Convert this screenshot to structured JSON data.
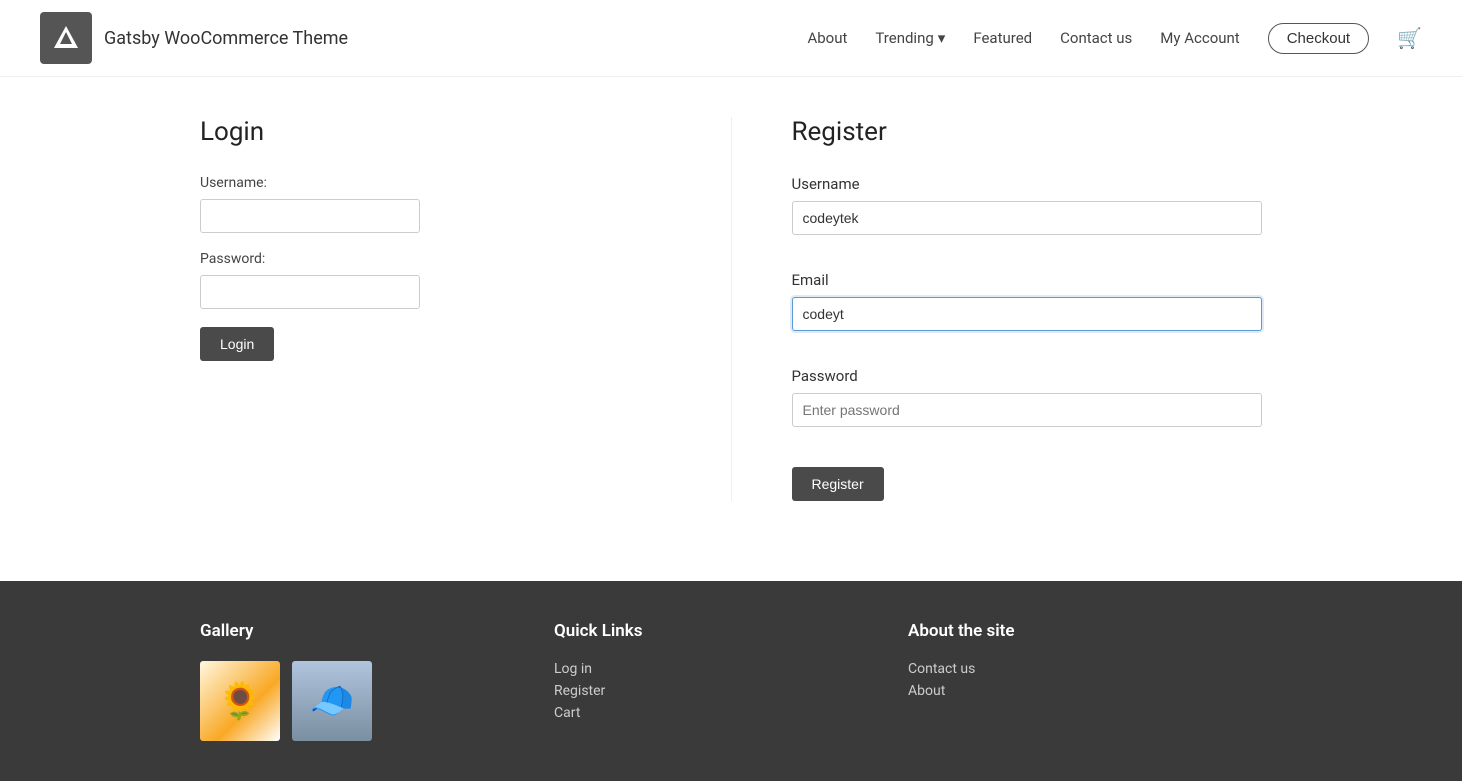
{
  "header": {
    "logo_title": "Gatsby WooCommerce Theme",
    "nav_items": [
      {
        "id": "about",
        "label": "About",
        "has_dropdown": false
      },
      {
        "id": "trending",
        "label": "Trending",
        "has_dropdown": true
      },
      {
        "id": "featured",
        "label": "Featured",
        "has_dropdown": false
      },
      {
        "id": "contact",
        "label": "Contact us",
        "has_dropdown": false
      },
      {
        "id": "myaccount",
        "label": "My Account",
        "has_dropdown": false
      }
    ],
    "checkout_label": "Checkout"
  },
  "login": {
    "title": "Login",
    "username_label": "Username:",
    "username_placeholder": "",
    "password_label": "Password:",
    "password_placeholder": "",
    "button_label": "Login"
  },
  "register": {
    "title": "Register",
    "username_label": "Username",
    "username_value": "codeytek",
    "email_label": "Email",
    "email_value": "codeyt",
    "password_label": "Password",
    "password_placeholder": "Enter password",
    "button_label": "Register"
  },
  "footer": {
    "gallery_title": "Gallery",
    "quicklinks_title": "Quick Links",
    "about_title": "About the site",
    "quick_links": [
      {
        "label": "Log in"
      },
      {
        "label": "Register"
      },
      {
        "label": "Cart"
      }
    ],
    "about_links": [
      {
        "label": "Contact us"
      },
      {
        "label": "About"
      }
    ]
  }
}
